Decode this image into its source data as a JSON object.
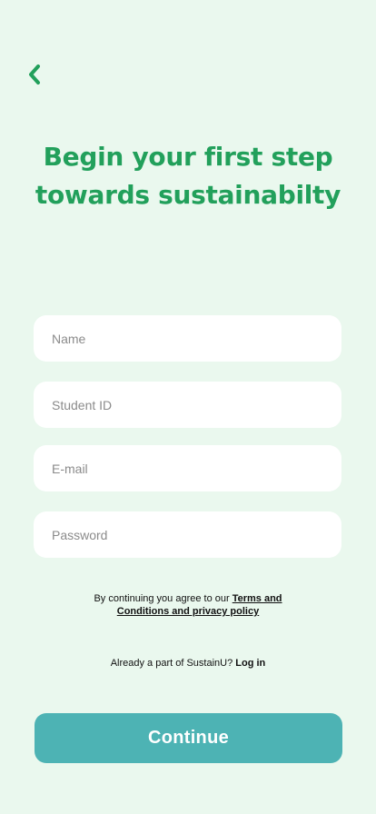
{
  "header": {
    "back_icon": "chevron-left-icon",
    "title_line1": "Begin your first step",
    "title_line2": "towards sustainabilty"
  },
  "form": {
    "name_placeholder": "Name",
    "student_id_placeholder": "Student ID",
    "email_placeholder": "E-mail",
    "password_placeholder": "Password"
  },
  "legal": {
    "prefix": "By continuing you agree to our ",
    "link_line1": "Terms and",
    "link_line2": "Conditions and privacy policy"
  },
  "login": {
    "prefix": "Already a part of SustainU? ",
    "link": "Log in"
  },
  "actions": {
    "continue_label": "Continue"
  },
  "colors": {
    "background": "#EAF8EE",
    "accent_green": "#22A05B",
    "button_teal": "#4DB3B4"
  }
}
